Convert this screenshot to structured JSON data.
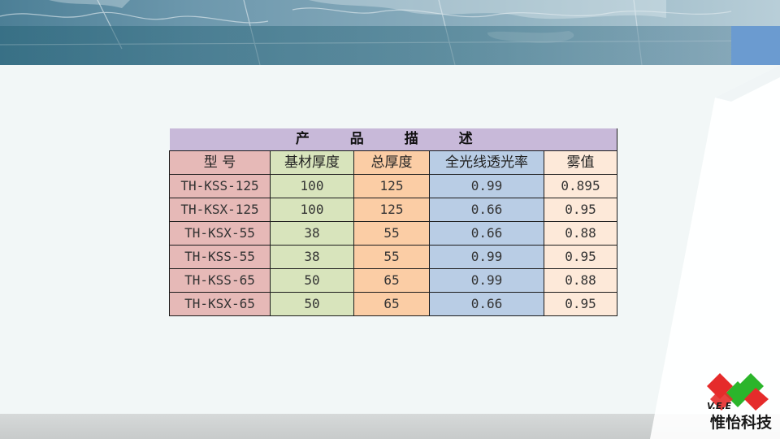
{
  "table": {
    "title": "产 品 描 述",
    "headers": [
      "型 号",
      "基材厚度",
      "总厚度",
      "全光线透光率",
      "雾值"
    ],
    "rows": [
      [
        "TH-KSS-125",
        "100",
        "125",
        "0.99",
        "0.895"
      ],
      [
        "TH-KSX-125",
        "100",
        "125",
        "0.66",
        "0.95"
      ],
      [
        "TH-KSX-55",
        "38",
        "55",
        "0.66",
        "0.88"
      ],
      [
        "TH-KSS-55",
        "38",
        "55",
        "0.99",
        "0.95"
      ],
      [
        "TH-KSS-65",
        "50",
        "65",
        "0.99",
        "0.88"
      ],
      [
        "TH-KSX-65",
        "50",
        "65",
        "0.66",
        "0.95"
      ]
    ],
    "column_colors": [
      "#e6b9b7",
      "#d8e4bc",
      "#fbcda5",
      "#b9cde5",
      "#fde9d9"
    ],
    "title_color": "#c8b9d9"
  },
  "logo": {
    "mark_text": "V.E.E",
    "company_name": "惟怡科技",
    "colors": [
      "#e52b2b",
      "#2bb52b"
    ]
  },
  "decor": {
    "banner_icon": "world-map-texture",
    "accent_color": "#6b9bd0"
  }
}
